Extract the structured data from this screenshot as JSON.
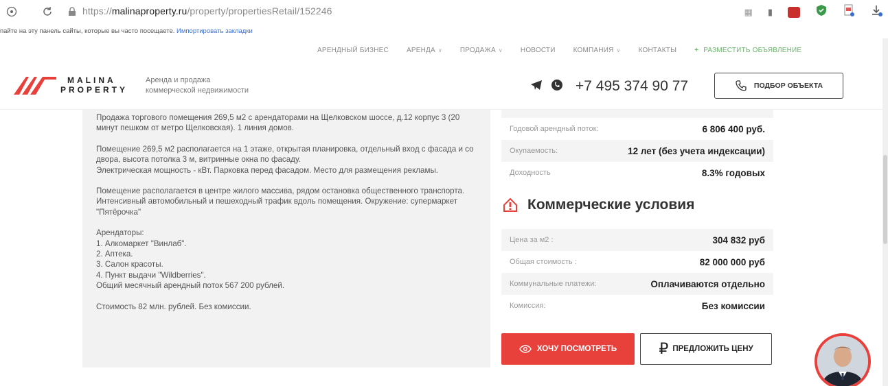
{
  "browser": {
    "url_prefix": "https://",
    "url_domain": "malinaproperty.ru",
    "url_path": "/property/propertiesRetail/152246",
    "bookmarks_text": "пайте на эту панель сайты, которые вы часто посещаете.",
    "bookmarks_link": "Импортировать закладки"
  },
  "topnav": [
    {
      "label": "Арендный бизнес",
      "chevron": false
    },
    {
      "label": "Аренда",
      "chevron": true
    },
    {
      "label": "Продажа",
      "chevron": true
    },
    {
      "label": "Новости",
      "chevron": false
    },
    {
      "label": "Компания",
      "chevron": true
    },
    {
      "label": "Контакты",
      "chevron": false
    }
  ],
  "place_ad": {
    "plus": "+",
    "label": "Разместить объявление"
  },
  "logo": {
    "line1": "MALINA",
    "line2": "PROPERTY",
    "tagline": "Аренда и продажа\nкоммерческой недвижимости"
  },
  "phone": "+7 495 374 90 77",
  "pick_button": "Подбор объекта",
  "description": [
    "Продажа торгового помещения 269,5 м2 с арендаторами на Щелковском шоссе, д.12 корпус 3 (20 минут пешком от метро Щелковская). 1 линия домов.",
    "Помещение 269,5 м2 располагается на 1 этаже, открытая планировка, отдельный вход с фасада и со двора, высота потолка 3 м, витринные окна по фасаду.\nЭлектрическая мощность - кВт. Парковка перед фасадом. Место для размещения рекламы.",
    "Помещение располагается в центре жилого массива, рядом остановка общественного транспорта. Интенсивный автомобильный и пешеходный трафик вдоль помещения. Окружение: супермаркет \"Пятёрочка\"",
    "Арендаторы:\n1. Алкомаркет \"Винлаб\".\n2. Аптека.\n3. Салон красоты.\n4. Пункт выдачи \"Wildberries\".\nОбщий месячный арендный поток 567 200 рублей.",
    "Стоимость 82 млн. рублей. Без комиссии."
  ],
  "investment_rows": [
    {
      "label": "Годовой арендный поток:",
      "value": "6 806 400 руб."
    },
    {
      "label": "Окупаемость:",
      "value": "12 лет (без учета индексации)"
    },
    {
      "label": "Доходность",
      "value": "8.3% годовых"
    }
  ],
  "conditions_title": "Коммерческие условия",
  "conditions_rows": [
    {
      "label": "Цена за м2 :",
      "value": "304 832 руб"
    },
    {
      "label": "Общая стоимость :",
      "value": "82 000 000 руб"
    },
    {
      "label": "Коммунальные платежи:",
      "value": "Оплачиваются отдельно"
    },
    {
      "label": "Комиссия:",
      "value": "Без комиссии"
    }
  ],
  "btn_see": "Хочу посмотреть",
  "btn_offer": "Предложить цену",
  "colors": {
    "accent": "#e8413c",
    "green": "#6bb36b"
  }
}
